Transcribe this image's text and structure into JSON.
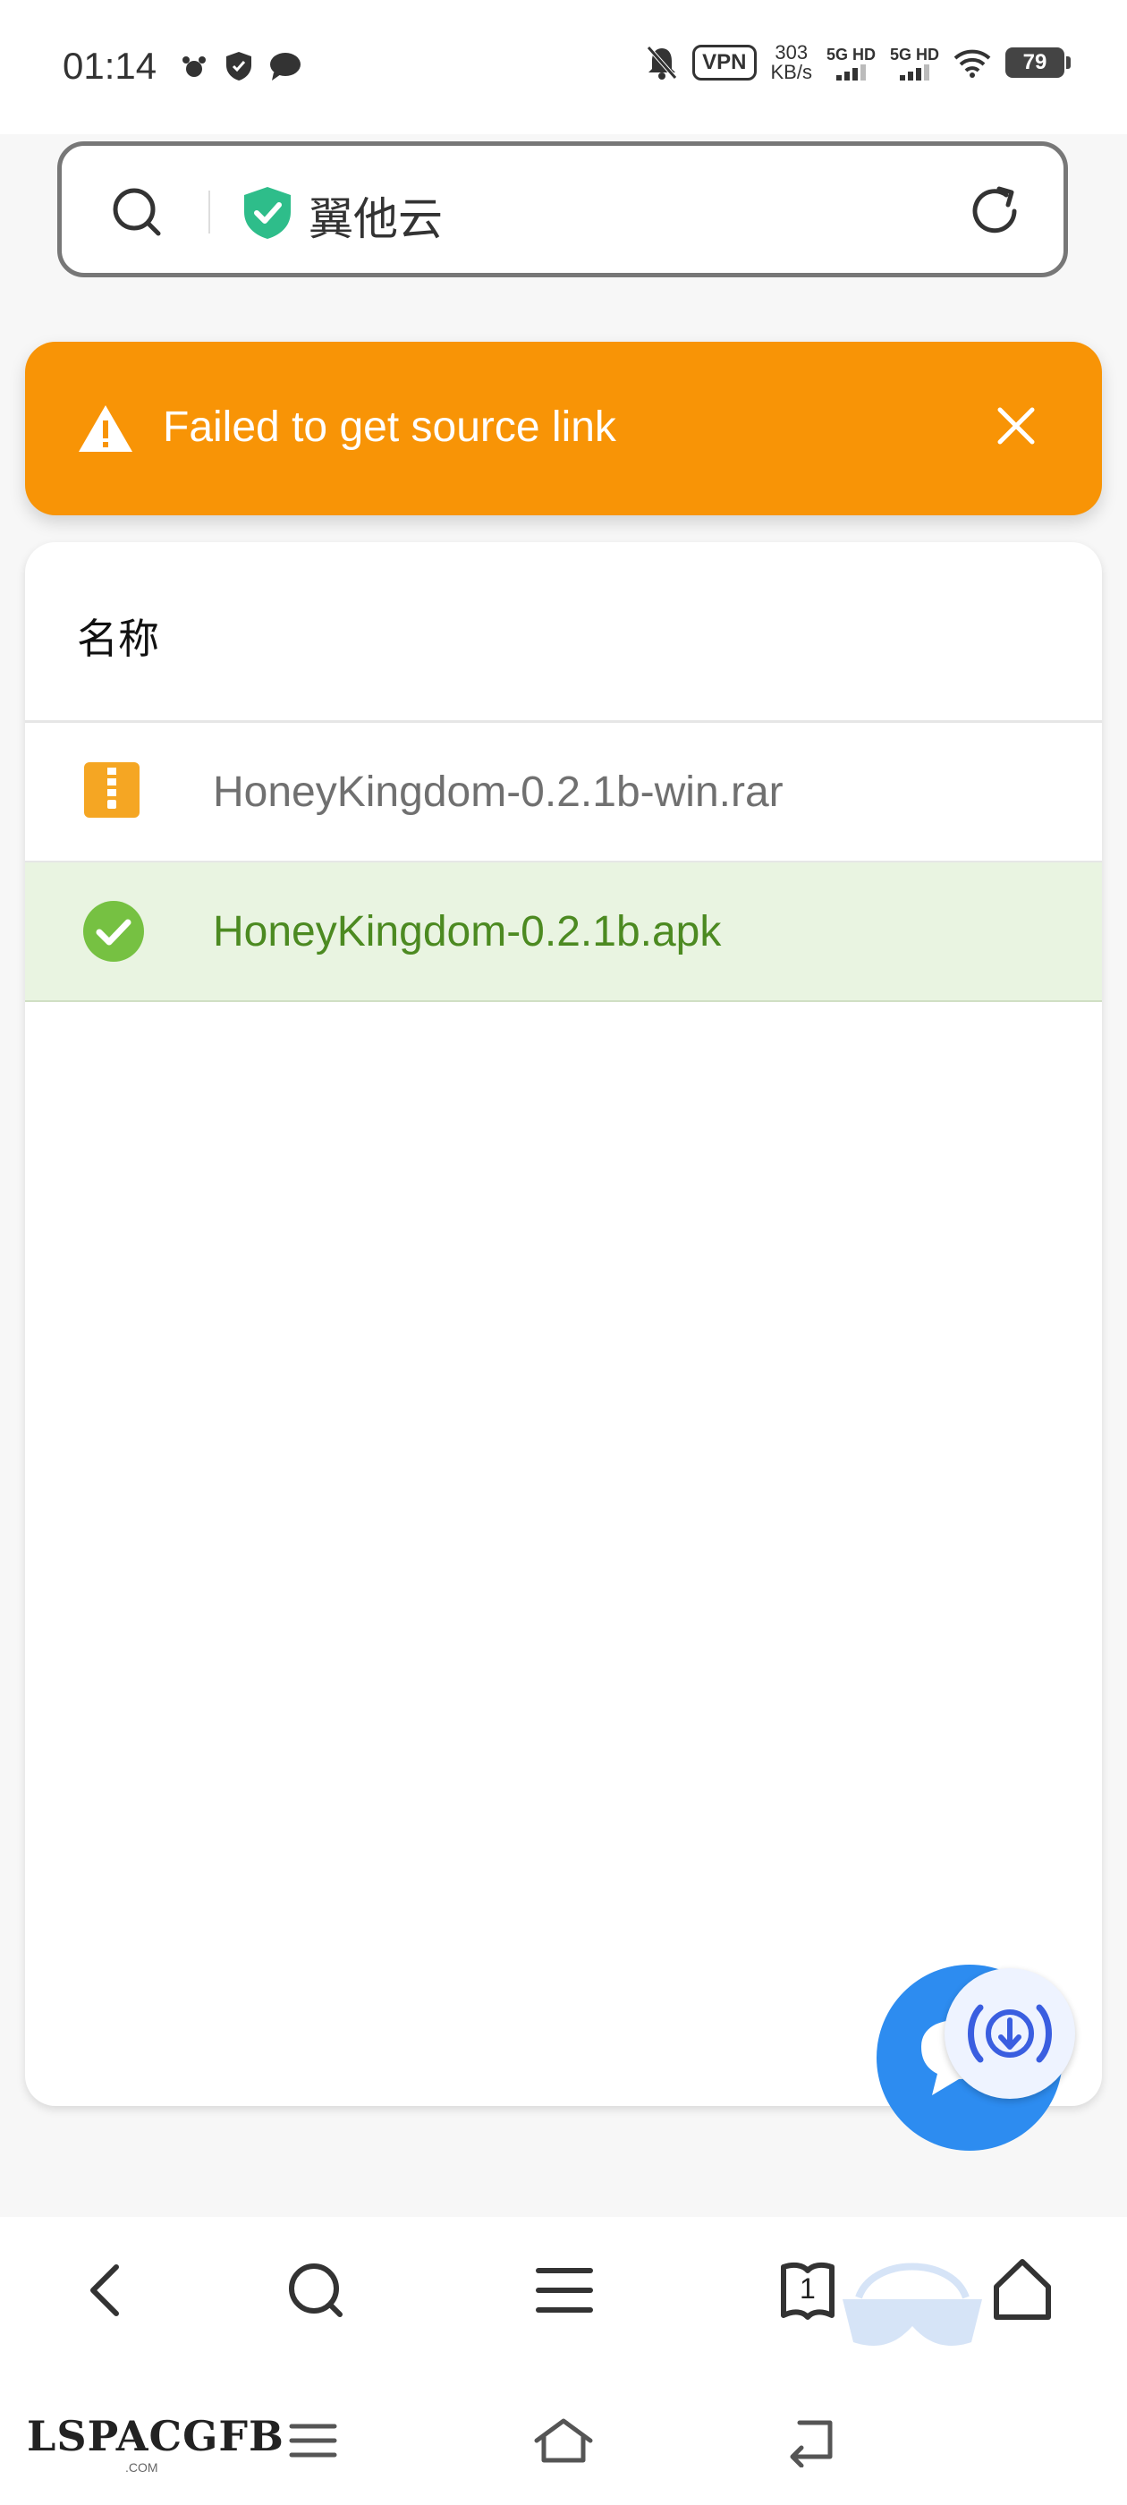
{
  "status_bar": {
    "time": "01:14",
    "vpn": "VPN",
    "speed_value": "303",
    "speed_unit": "KB/s",
    "signal1": "5G HD",
    "signal2": "5G HD",
    "battery": "79"
  },
  "url_bar": {
    "site_title": "翼他云"
  },
  "toast": {
    "message": "Failed to get source link",
    "color": "#f89406"
  },
  "file_list": {
    "column_header": "名称",
    "rows": [
      {
        "name": "HoneyKingdom-0.2.1b-win.rar",
        "icon": "archive-icon",
        "selected": false
      },
      {
        "name": "HoneyKingdom-0.2.1b.apk",
        "icon": "check-circle-icon",
        "selected": true
      }
    ]
  },
  "toolbar": {
    "tab_count": "1"
  },
  "watermark": {
    "text": "LSPACGFB",
    "sub": ".COM"
  },
  "colors": {
    "accent_blue": "#2d8cf0",
    "selected_bg": "#e9f4e1",
    "selected_text": "#4c8a21",
    "archive_icon": "#f5a623"
  }
}
